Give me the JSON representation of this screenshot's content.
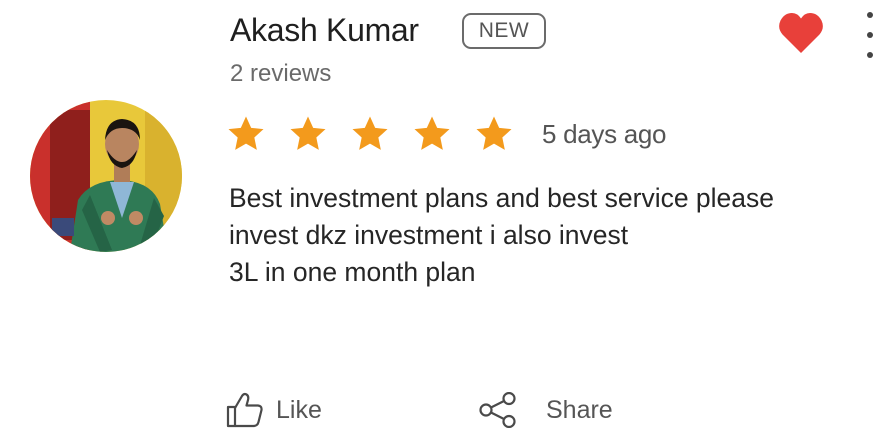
{
  "reviewer": {
    "name": "Akash Kumar",
    "badge": "NEW",
    "review_count": "2 reviews",
    "avatar_icon": "reviewer-photo"
  },
  "rating": {
    "stars": 5,
    "max": 5,
    "star_color": "#f39a1c",
    "time_ago": "5 days ago"
  },
  "review": {
    "lines": [
      "Best investment plans and best service please",
      "invest dkz investment i also invest",
      "3L in one month plan"
    ]
  },
  "actions": {
    "like_label": "Like",
    "share_label": "Share",
    "favorite_icon": "heart-icon",
    "favorite_color": "#e8403a",
    "more_icon": "more-vertical-icon"
  }
}
